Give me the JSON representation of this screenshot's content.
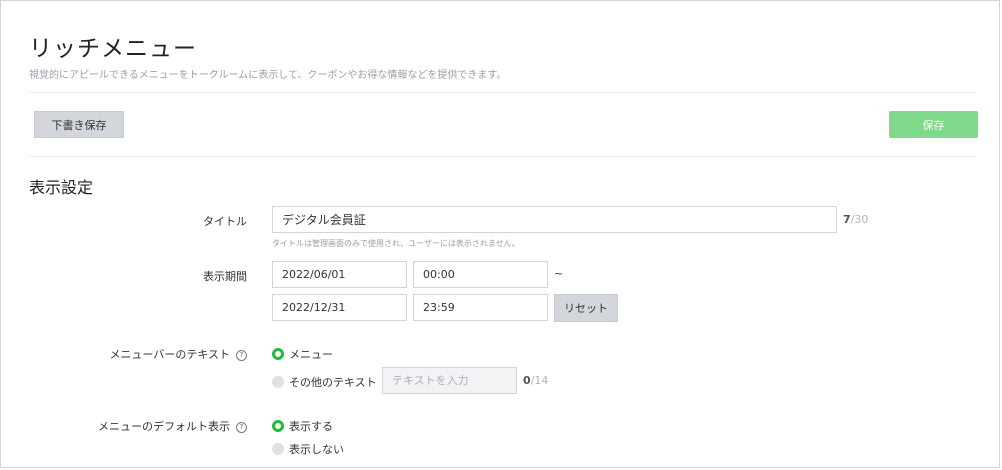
{
  "page": {
    "title": "リッチメニュー",
    "description": "視覚的にアピールできるメニューをトークルームに表示して、クーポンやお得な情報などを提供できます。"
  },
  "toolbar": {
    "draft_label": "下書き保存",
    "save_label": "保存"
  },
  "section": {
    "title": "表示設定"
  },
  "form": {
    "title_field": {
      "label": "タイトル",
      "value": "デジタル会員証",
      "count": "7",
      "max": "/30",
      "hint": "タイトルは管理画面のみで使用され、ユーザーには表示されません。"
    },
    "period": {
      "label": "表示期間",
      "start_date": "2022/06/01",
      "start_time": "00:00",
      "tilde": "~",
      "end_date": "2022/12/31",
      "end_time": "23:59",
      "reset_label": "リセット"
    },
    "menubar_text": {
      "label": "メニューバーのテキスト",
      "help": "?",
      "options": [
        {
          "label": "メニュー",
          "selected": true
        },
        {
          "label": "その他のテキスト",
          "selected": false
        }
      ],
      "custom_placeholder": "テキストを入力",
      "count": "0",
      "max": "/14"
    },
    "default_display": {
      "label": "メニューのデフォルト表示",
      "help": "?",
      "options": [
        {
          "label": "表示する",
          "selected": true
        },
        {
          "label": "表示しない",
          "selected": false
        }
      ]
    }
  },
  "colors": {
    "accent_green": "#1fbd3b",
    "save_button": "#7fd98a",
    "secondary_button": "#d3d6da"
  }
}
